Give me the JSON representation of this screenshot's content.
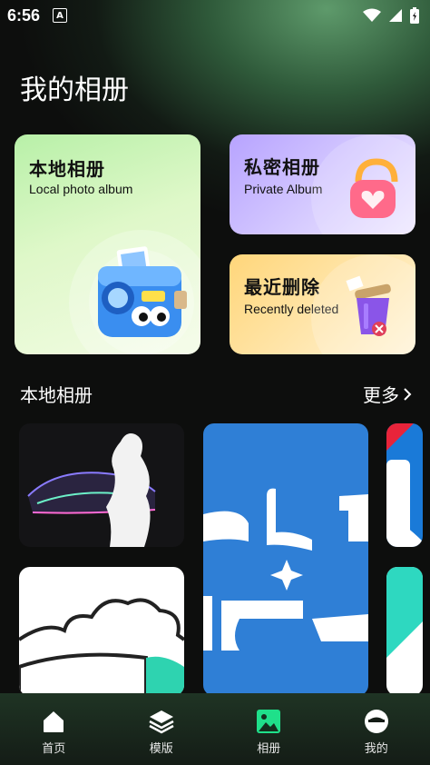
{
  "status_bar": {
    "time": "6:56",
    "notification_icon": "A"
  },
  "page": {
    "title": "我的相册"
  },
  "cards": {
    "local": {
      "title_cn": "本地相册",
      "title_en": "Local photo album"
    },
    "private": {
      "title_cn": "私密相册",
      "title_en": "Private Album"
    },
    "deleted": {
      "title_cn": "最近删除",
      "title_en": "Recently deleted"
    }
  },
  "section": {
    "title": "本地相册",
    "more_label": "更多"
  },
  "tabs": [
    {
      "label": "首页",
      "icon": "home-icon",
      "active": false
    },
    {
      "label": "模版",
      "icon": "layers-icon",
      "active": false
    },
    {
      "label": "相册",
      "icon": "image-icon",
      "active": true
    },
    {
      "label": "我的",
      "icon": "profile-icon",
      "active": false
    }
  ],
  "colors": {
    "accent": "#1fe08a",
    "background": "#0d0e0d"
  }
}
